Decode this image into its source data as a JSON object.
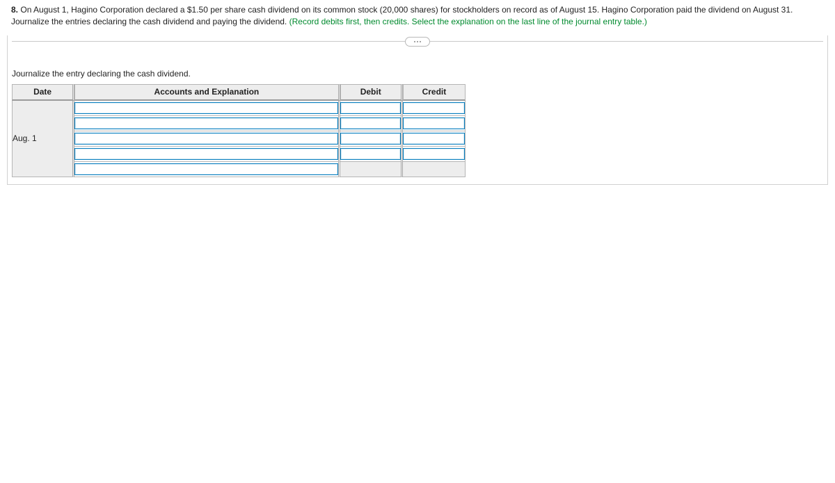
{
  "question": {
    "number": "8.",
    "text_before_green": "On August 1, Hagino Corporation declared a $1.50 per share cash dividend on its common stock (20,000 shares) for stockholders on record as of August 15. Hagino Corporation paid the dividend on August 31. Journalize the entries declaring the cash dividend and paying the dividend. ",
    "green_text": "(Record debits first, then credits. Select the explanation on the last line of the journal entry table.)"
  },
  "subprompt": "Journalize the entry declaring the cash dividend.",
  "table": {
    "headers": {
      "date": "Date",
      "accounts": "Accounts and Explanation",
      "debit": "Debit",
      "credit": "Credit"
    },
    "date_value": "Aug. 1",
    "rows": [
      {
        "account": "",
        "debit": "",
        "credit": ""
      },
      {
        "account": "",
        "debit": "",
        "credit": ""
      },
      {
        "account": "",
        "debit": "",
        "credit": ""
      },
      {
        "account": "",
        "debit": "",
        "credit": ""
      }
    ],
    "explanation_row": {
      "account": ""
    }
  }
}
